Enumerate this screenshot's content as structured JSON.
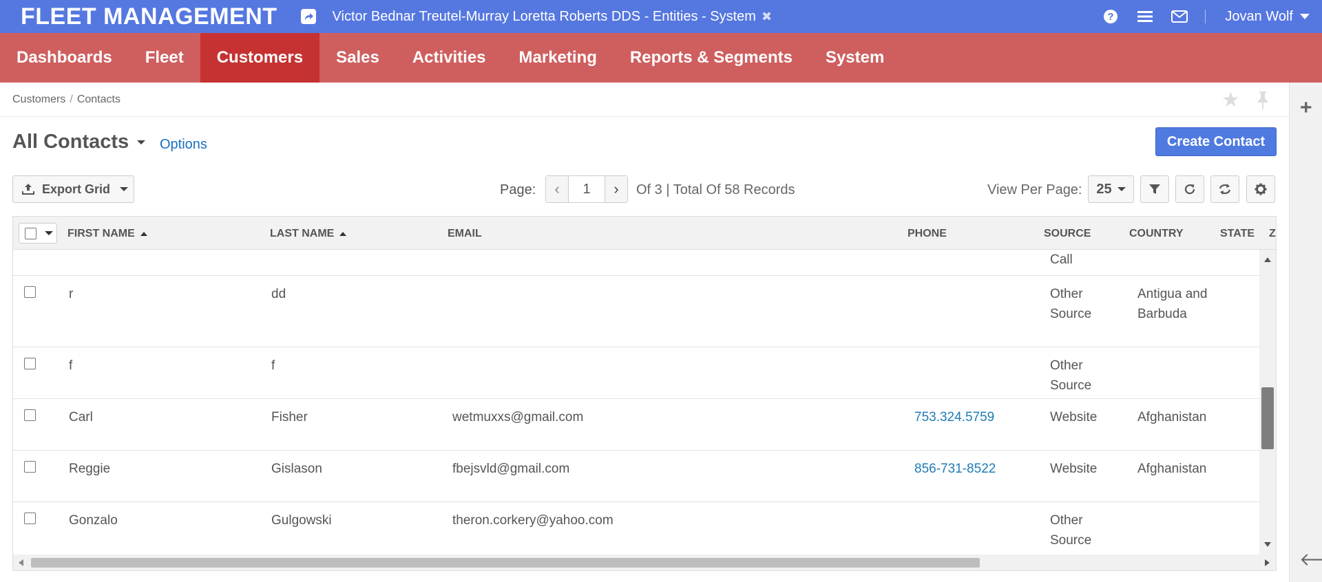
{
  "app": {
    "brand": "FLEET MANAGEMENT"
  },
  "recent": {
    "title": "Victor Bednar Treutel-Murray Loretta Roberts DDS - Entities - System"
  },
  "user": {
    "name": "Jovan Wolf"
  },
  "nav": [
    "Dashboards",
    "Fleet",
    "Customers",
    "Sales",
    "Activities",
    "Marketing",
    "Reports & Segments",
    "System"
  ],
  "breadcrumb": [
    "Customers",
    "Contacts"
  ],
  "page": {
    "title": "All Contacts",
    "options_label": "Options",
    "create_label": "Create Contact"
  },
  "toolbar": {
    "export_label": "Export Grid",
    "page_label": "Page:",
    "page_value": "1",
    "records_text": "Of 3 | Total Of 58 Records",
    "view_per_page_label": "View Per Page:",
    "view_per_page_value": "25"
  },
  "grid": {
    "columns": [
      "First Name",
      "Last Name",
      "Email",
      "Phone",
      "Source",
      "Country",
      "State",
      "Z"
    ],
    "partial_row": {
      "source": "Call"
    },
    "rows": [
      {
        "first_name": "r",
        "last_name": "dd",
        "email": "",
        "phone": "",
        "source": "Other Source",
        "country": "Antigua and Barbuda"
      },
      {
        "first_name": "f",
        "last_name": "f",
        "email": "",
        "phone": "",
        "source": "Other Source",
        "country": ""
      },
      {
        "first_name": "Carl",
        "last_name": "Fisher",
        "email": "wetmuxxs@gmail.com",
        "phone": "753.324.5759",
        "source": "Website",
        "country": "Afghanistan"
      },
      {
        "first_name": "Reggie",
        "last_name": "Gislason",
        "email": "fbejsvld@gmail.com",
        "phone": "856-731-8522",
        "source": "Website",
        "country": "Afghanistan"
      },
      {
        "first_name": "Gonzalo",
        "last_name": "Gulgowski",
        "email": "theron.corkery@yahoo.com",
        "phone": "",
        "source": "Other Source",
        "country": ""
      }
    ]
  },
  "colors": {
    "topbar": "#5577e0",
    "nav": "#cf5f5f",
    "nav_active": "#c63232",
    "primary": "#4f7ae0",
    "link": "#1f7bb5"
  }
}
